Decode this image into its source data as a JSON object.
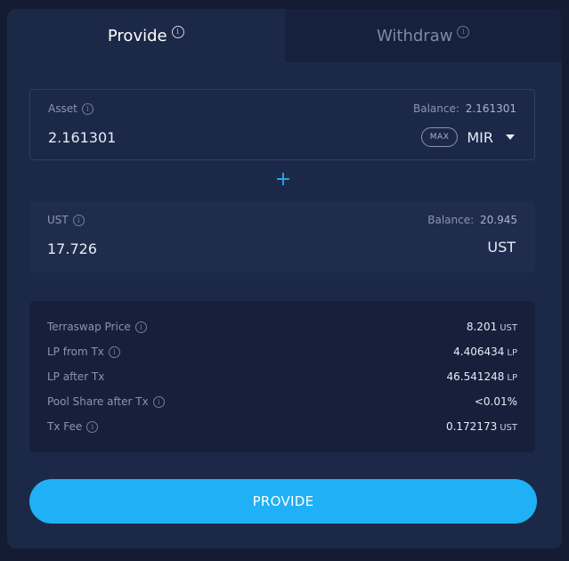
{
  "tabs": [
    {
      "label": "Provide",
      "active": true
    },
    {
      "label": "Withdraw",
      "active": false
    }
  ],
  "asset": {
    "label": "Asset",
    "balance_label": "Balance:",
    "balance_value": "2.161301",
    "amount": "2.161301",
    "max_label": "MAX",
    "token": "MIR"
  },
  "plus_symbol": "+",
  "ust": {
    "label": "UST",
    "balance_label": "Balance:",
    "balance_value": "20.945",
    "amount": "17.726",
    "token": "UST"
  },
  "summary": [
    {
      "label": "Terraswap Price",
      "value": "8.201",
      "unit": "UST",
      "info": true
    },
    {
      "label": "LP from Tx",
      "value": "4.406434",
      "unit": "LP",
      "info": true
    },
    {
      "label": "LP after Tx",
      "value": "46.541248",
      "unit": "LP",
      "info": false
    },
    {
      "label": "Pool Share after Tx",
      "value": "<0.01%",
      "unit": "",
      "info": true
    },
    {
      "label": "Tx Fee",
      "value": "0.172173",
      "unit": "UST",
      "info": true
    }
  ],
  "submit_label": "PROVIDE",
  "colors": {
    "background": "#141c33",
    "card": "#1b2847",
    "accent": "#1fb0f5",
    "plus": "#2aa8f2"
  },
  "icons": [
    "info-icon",
    "caret-down-icon",
    "plus-icon"
  ]
}
